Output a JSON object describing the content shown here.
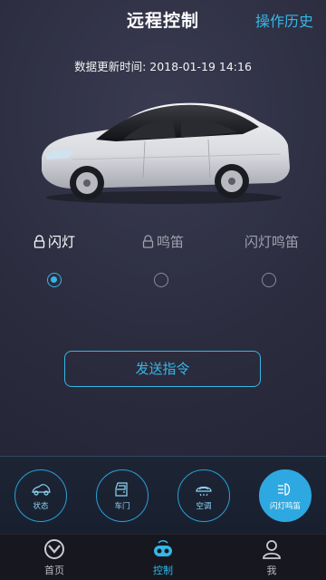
{
  "header": {
    "title": "远程控制",
    "history_label": "操作历史"
  },
  "update": {
    "label": "数据更新时间:",
    "time": "2018-01-19 14:16"
  },
  "modes": [
    {
      "label": "闪灯",
      "locked": true,
      "active": true
    },
    {
      "label": "鸣笛",
      "locked": true,
      "active": false
    },
    {
      "label": "闪灯鸣笛",
      "locked": false,
      "active": false
    }
  ],
  "send_button": {
    "label": "发送指令"
  },
  "dock": [
    {
      "label": "状态",
      "icon": "car-status-icon",
      "active": false
    },
    {
      "label": "车门",
      "icon": "car-door-icon",
      "active": false
    },
    {
      "label": "空调",
      "icon": "air-conditioner-icon",
      "active": false
    },
    {
      "label": "闪灯鸣笛",
      "icon": "headlight-icon",
      "active": true
    }
  ],
  "nav": [
    {
      "label": "首页",
      "icon": "home-logo-icon",
      "active": false
    },
    {
      "label": "控制",
      "icon": "remote-control-icon",
      "active": true
    },
    {
      "label": "我",
      "icon": "user-icon",
      "active": false
    }
  ],
  "colors": {
    "accent": "#35b7e6",
    "background": "#2b2c3e"
  }
}
